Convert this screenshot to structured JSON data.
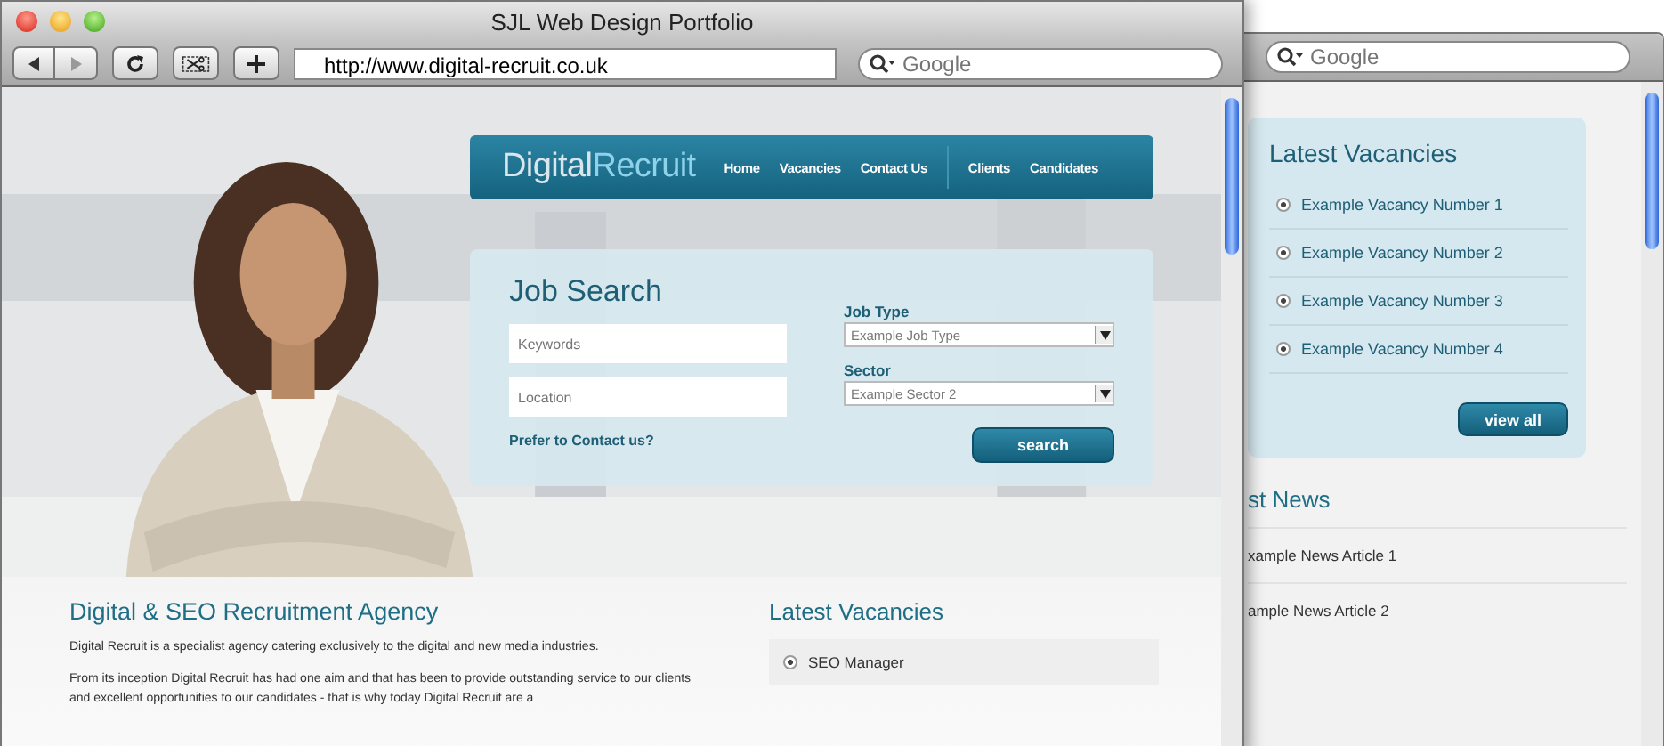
{
  "main_window": {
    "title": "SJL Web Design Portfolio",
    "url": "http://www.digital-recruit.co.uk",
    "search": {
      "placeholder": "Google"
    }
  },
  "site": {
    "logo": {
      "first": "Digital",
      "second": "Recruit"
    },
    "nav_main": [
      "Home",
      "Vacancies",
      "Contact Us"
    ],
    "nav_audience": [
      "Clients",
      "Candidates"
    ],
    "job_search": {
      "title": "Job Search",
      "keywords": {
        "placeholder": "Keywords"
      },
      "location": {
        "placeholder": "Location"
      },
      "contact_link": "Prefer to Contact us?",
      "job_type": {
        "label": "Job Type",
        "value": "Example Job Type"
      },
      "sector": {
        "label": "Sector",
        "value": "Example Sector 2"
      },
      "button": "search"
    },
    "intro": {
      "heading": "Digital & SEO Recruitment Agency",
      "paragraphs": [
        "Digital Recruit is a specialist agency catering exclusively to the digital and new media industries.",
        "From its inception Digital Recruit has had one aim and that has been to provide outstanding service to our clients and excellent opportunities to our candidates - that is why today Digital Recruit are a"
      ]
    },
    "latest_vacancies": {
      "title": "Latest Vacancies",
      "items": [
        "SEO Manager"
      ]
    }
  },
  "back_window": {
    "search": {
      "placeholder": "Google"
    },
    "vacancies": {
      "title": "Latest Vacancies",
      "items": [
        "Example Vacancy Number 1",
        "Example Vacancy Number 2",
        "Example Vacancy Number 3",
        "Example Vacancy Number 4"
      ],
      "button": "view all"
    },
    "news": {
      "title": "st News",
      "items": [
        "xample News Article 1",
        "ample News Article 2"
      ]
    }
  }
}
